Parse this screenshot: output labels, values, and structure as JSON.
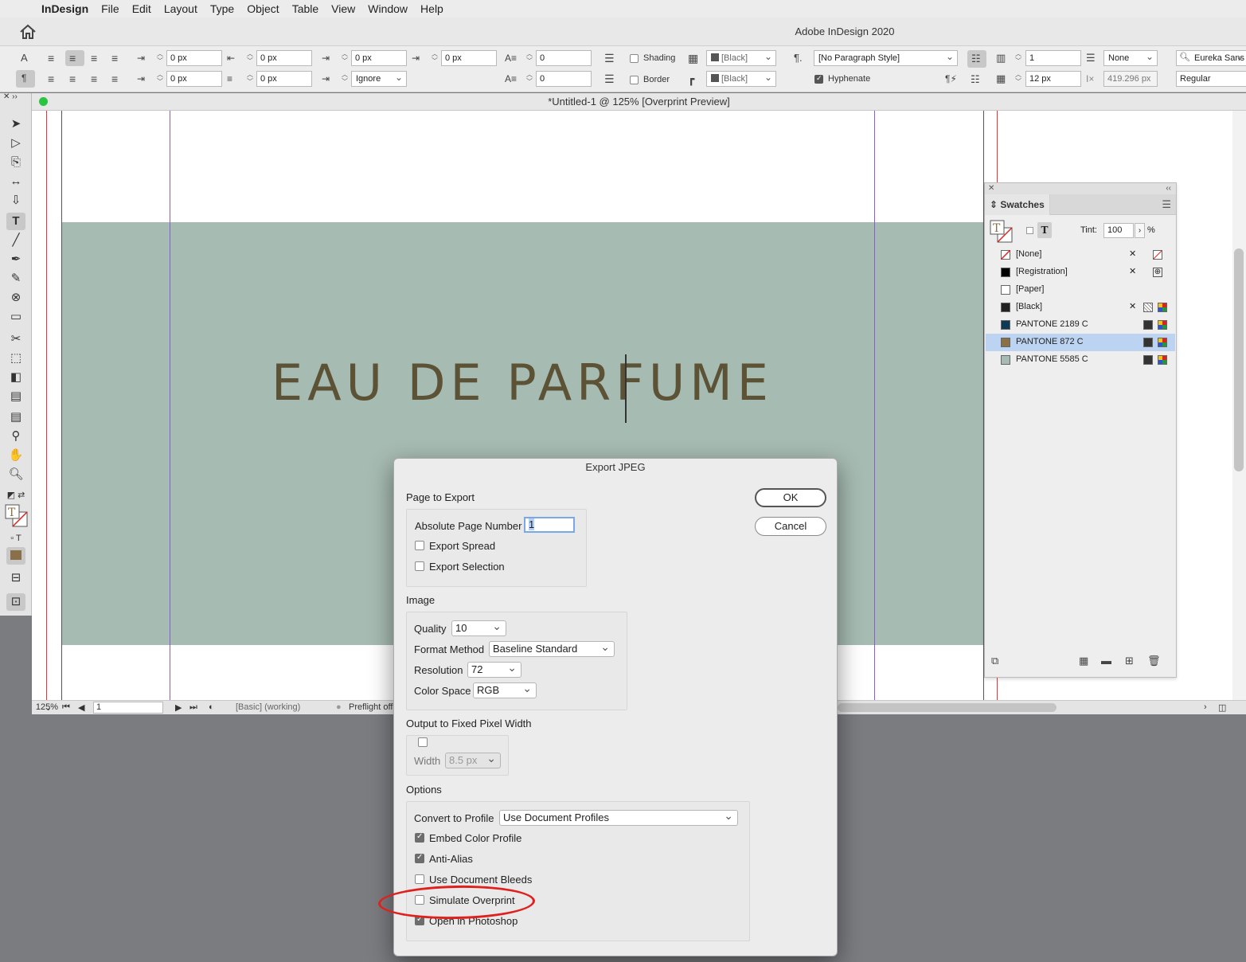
{
  "menubar": {
    "app_name": "InDesign",
    "items": [
      "File",
      "Edit",
      "Layout",
      "Type",
      "Object",
      "Table",
      "View",
      "Window",
      "Help"
    ]
  },
  "appbar": {
    "title": "Adobe InDesign 2020"
  },
  "control": {
    "left_indent": "0 px",
    "right_indent": "0 px",
    "first_indent": "0 px",
    "last_indent": "0 px",
    "space_before": "0 px",
    "space_after": "0 px",
    "drop_indent": "0 px",
    "align_grid": "Ignore",
    "drop_lines": "0",
    "drop_chars": "0",
    "shading_label": "Shading",
    "border_label": "Border",
    "shading_color": "[Black]",
    "border_color": "[Black]",
    "paragraph_style": "[No Paragraph Style]",
    "hyphenate_label": "Hyphenate",
    "columns": "1",
    "gutter": "12 px",
    "span": "None",
    "width_readout": "419.296 px",
    "font_family": "Eureka Sans",
    "font_style": "Regular"
  },
  "document": {
    "title": "*Untitled-1 @ 125% [Overprint Preview]",
    "headline": "EAU DE PARFUME",
    "band_color": "#a6bbb2",
    "text_color": "#5c5236"
  },
  "status": {
    "zoom": "125%",
    "page": "1",
    "profile": "[Basic] (working)",
    "preflight": "Preflight off"
  },
  "swatches": {
    "tab": "Swatches",
    "tint_label": "Tint:",
    "tint_value": "100",
    "tint_unit": "%",
    "items": [
      {
        "name": "[None]",
        "color": "#ffffff"
      },
      {
        "name": "[Registration]",
        "color": "#000000"
      },
      {
        "name": "[Paper]",
        "color": "#ffffff"
      },
      {
        "name": "[Black]",
        "color": "#222222"
      },
      {
        "name": "PANTONE 2189 C",
        "color": "#0e3a55"
      },
      {
        "name": "PANTONE 872 C",
        "color": "#8a7048"
      },
      {
        "name": "PANTONE 5585 C",
        "color": "#a6bbb2"
      }
    ],
    "selected": "PANTONE 872 C"
  },
  "dialog": {
    "title": "Export JPEG",
    "ok": "OK",
    "cancel": "Cancel",
    "page_section": "Page to Export",
    "page_number_label": "Absolute Page Number",
    "page_number_value": "1",
    "export_spread": "Export Spread",
    "export_selection": "Export Selection",
    "image_section": "Image",
    "quality_label": "Quality",
    "quality_value": "10",
    "format_label": "Format Method",
    "format_value": "Baseline Standard",
    "resolution_label": "Resolution",
    "resolution_value": "72",
    "colorspace_label": "Color Space",
    "colorspace_value": "RGB",
    "fixed_width_section": "Output to Fixed Pixel Width",
    "width_label": "Width",
    "width_value": "8.5 px",
    "options_section": "Options",
    "profile_label": "Convert to Profile",
    "profile_value": "Use Document Profiles",
    "embed_profile": "Embed Color Profile",
    "anti_alias": "Anti-Alias",
    "use_bleeds": "Use Document Bleeds",
    "simulate_overprint": "Simulate Overprint",
    "open_photoshop": "Open in Photoshop"
  }
}
